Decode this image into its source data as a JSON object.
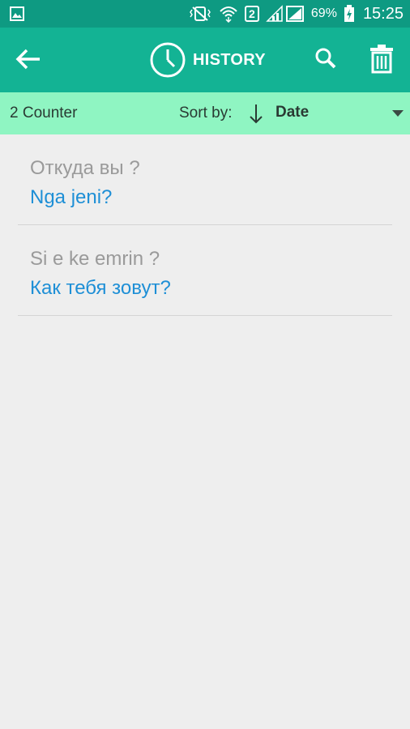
{
  "status_bar": {
    "battery": "69%",
    "time": "15:25",
    "sim_label": "2",
    "icons": [
      "gallery-icon",
      "vibrate-icon",
      "wifi-icon",
      "sim-icon",
      "signal-icon",
      "battery-icon"
    ]
  },
  "app_bar": {
    "title": "HISTORY",
    "icons": [
      "back-arrow-icon",
      "clock-icon",
      "search-icon",
      "trash-icon"
    ]
  },
  "sort_bar": {
    "counter": "2 Counter",
    "sort_label": "Sort by:",
    "sort_value": "Date"
  },
  "history": [
    {
      "source": "Откуда вы ?",
      "translation": "Nga jeni?"
    },
    {
      "source": "Si e ke emrin ?",
      "translation": "Как тебя зовут?"
    }
  ],
  "colors": {
    "status_bar": "#0e9a82",
    "app_bar": "#13b394",
    "sort_bar": "#8ff5c2",
    "background": "#eeeeee",
    "source_text": "#9a9a9a",
    "translation_text": "#1e8fd6"
  }
}
